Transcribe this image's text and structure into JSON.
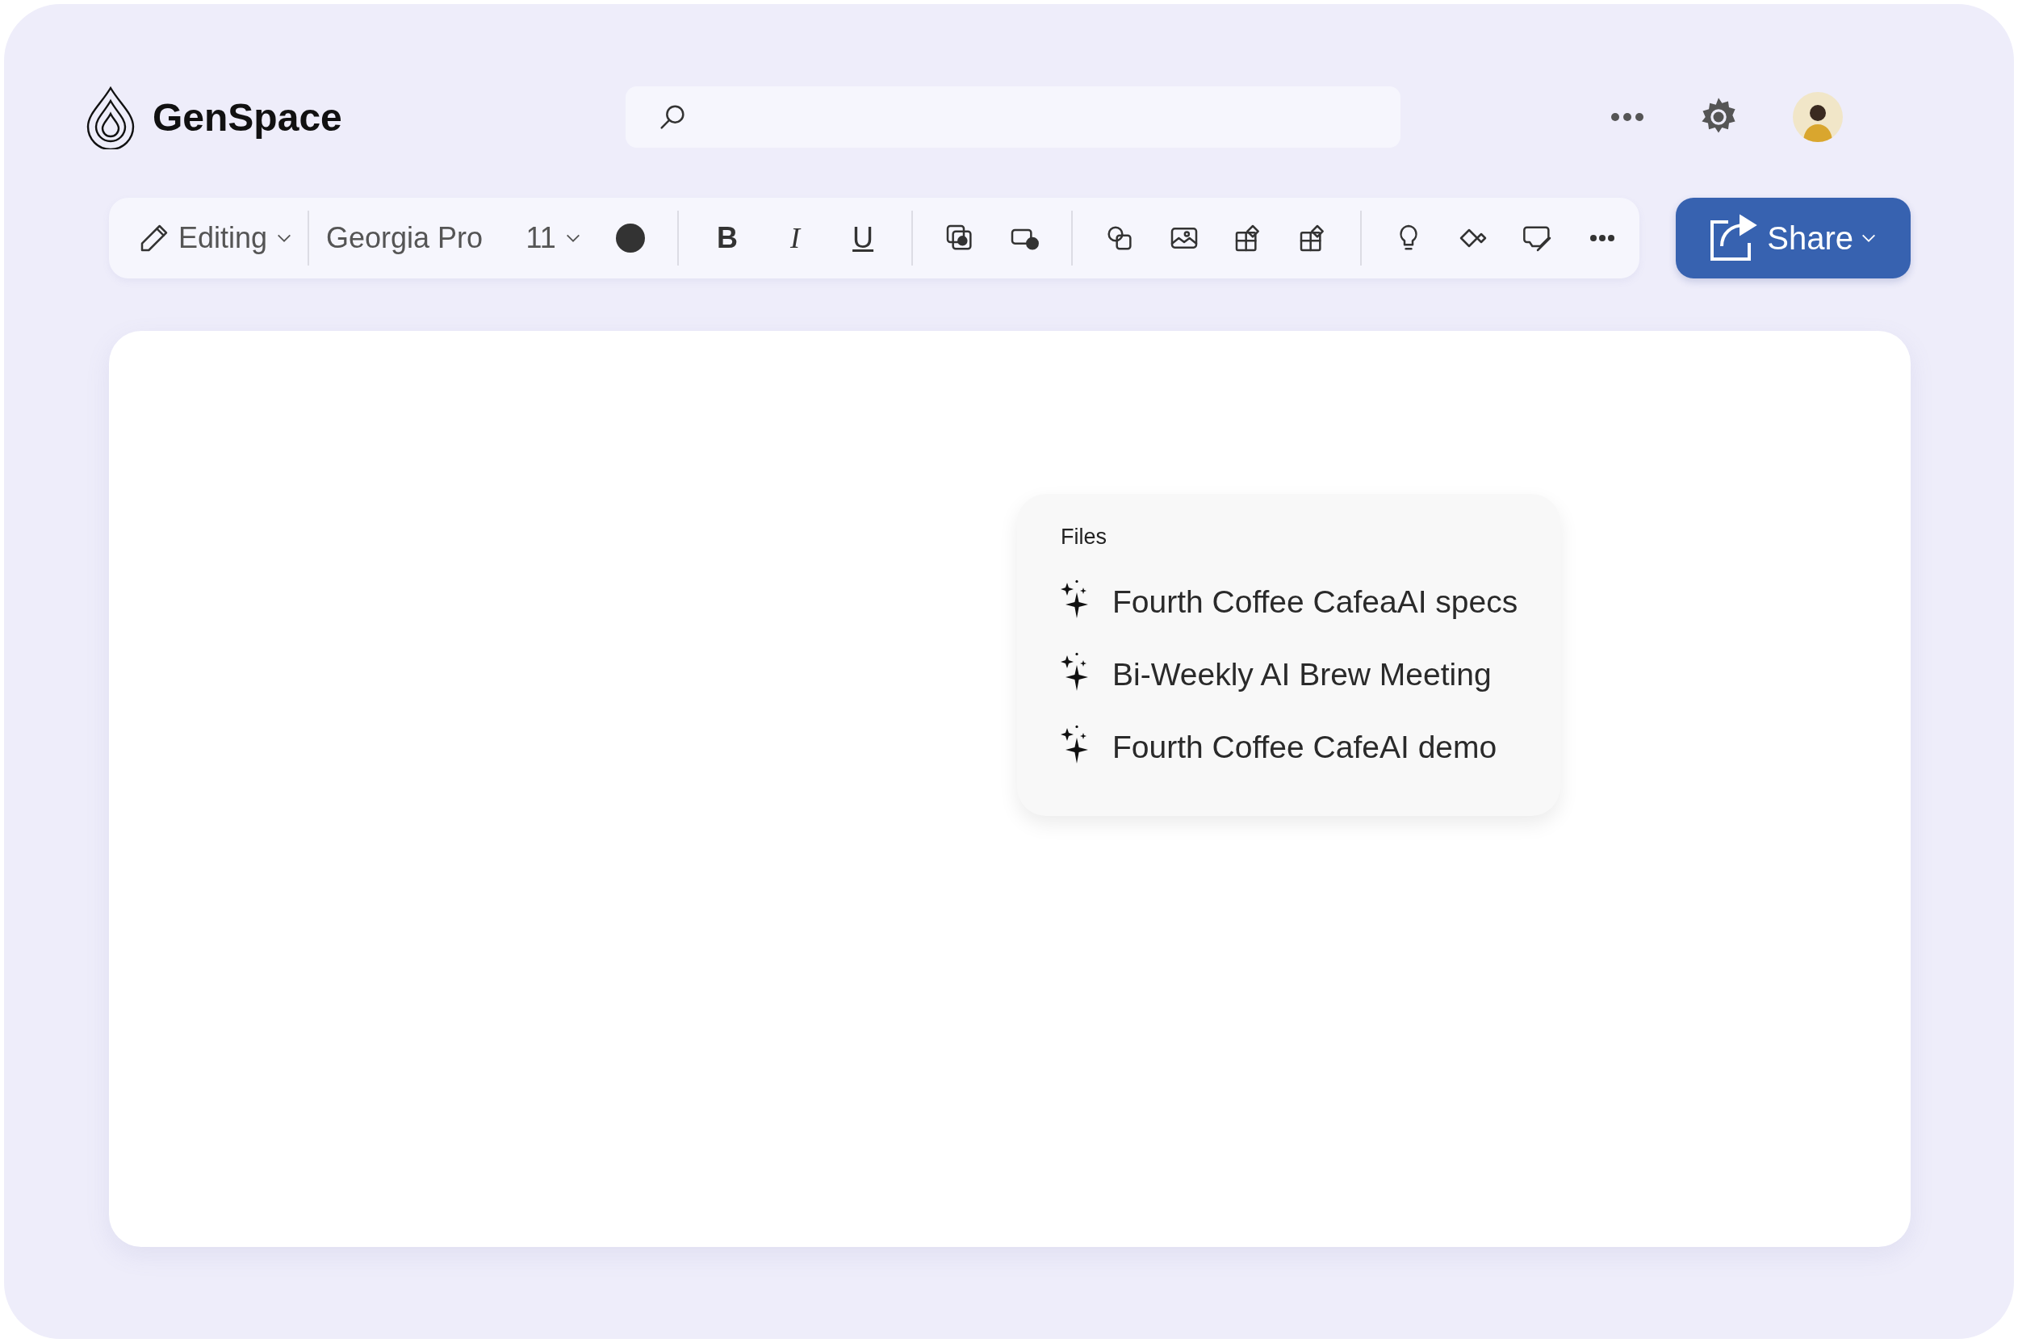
{
  "app": {
    "name": "GenSpace"
  },
  "toolbar": {
    "mode": "Editing",
    "font": "Georgia Pro",
    "size": "11",
    "format_buttons": [
      {
        "kind": "bold",
        "label": "B"
      },
      {
        "kind": "italic",
        "label": "I"
      },
      {
        "kind": "underline",
        "label": "U"
      }
    ]
  },
  "share_button": {
    "label": "Share"
  },
  "files_menu": {
    "heading": "Files",
    "items": [
      {
        "label": "Fourth Coffee CafeaAI specs"
      },
      {
        "label": "Bi-Weekly AI Brew Meeting"
      },
      {
        "label": "Fourth Coffee CafeAI demo"
      }
    ]
  }
}
